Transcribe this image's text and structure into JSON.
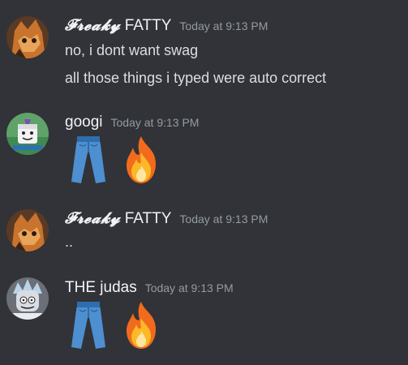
{
  "messages": [
    {
      "author_fancy": "𝓕𝓻𝓮𝓪𝓴𝔂",
      "author_rest": "FATTY",
      "timestamp": "Today at 9:13 PM",
      "lines": [
        "no, i dont want swag",
        "all those things i typed were auto correct"
      ]
    },
    {
      "author": "googi",
      "timestamp": "Today at 9:13 PM",
      "emojis": [
        "jeans-emoji",
        "fire-emoji"
      ]
    },
    {
      "author_fancy": "𝓕𝓻𝓮𝓪𝓴𝔂",
      "author_rest": "FATTY",
      "timestamp": "Today at 9:13 PM",
      "lines": [
        ".."
      ]
    },
    {
      "author": "THE judas",
      "timestamp": "Today at 9:13 PM",
      "emojis": [
        "jeans-emoji",
        "fire-emoji"
      ]
    }
  ],
  "colors": {
    "background": "#313338",
    "username": "#f2f3f5",
    "message_text": "#dbdee1",
    "timestamp": "#949ba4"
  }
}
